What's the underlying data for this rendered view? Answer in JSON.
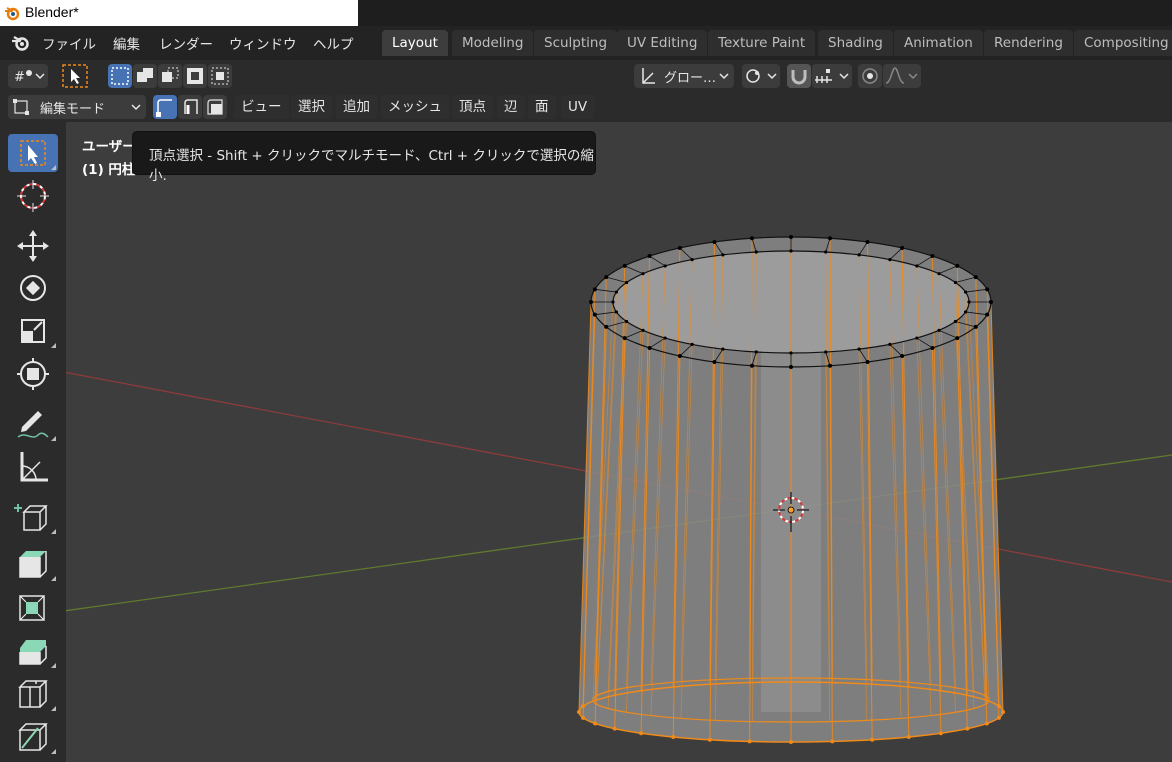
{
  "window": {
    "title": "Blender*"
  },
  "menus": [
    "ファイル",
    "編集",
    "レンダー",
    "ウィンドウ",
    "ヘルプ"
  ],
  "workspace_tabs": [
    {
      "label": "Layout",
      "active": true
    },
    {
      "label": "Modeling",
      "active": false
    },
    {
      "label": "Sculpting",
      "active": false
    },
    {
      "label": "UV Editing",
      "active": false
    },
    {
      "label": "Texture Paint",
      "active": false
    },
    {
      "label": "Shading",
      "active": false
    },
    {
      "label": "Animation",
      "active": false
    },
    {
      "label": "Rendering",
      "active": false
    },
    {
      "label": "Compositing",
      "active": false
    }
  ],
  "header": {
    "transform_orientation": "グロー…",
    "mode": "編集モード",
    "menus": [
      "ビュー",
      "選択",
      "追加",
      "メッシュ",
      "頂点",
      "辺",
      "面",
      "UV"
    ]
  },
  "viewport": {
    "view_label": "ユーザー",
    "object_label": "(1) 円柱"
  },
  "tooltip": {
    "text": "頂点選択 - Shift + クリックでマルチモード、Ctrl + クリックで選択の縮小."
  },
  "tools": [
    "select-box",
    "cursor",
    "move",
    "rotate",
    "scale",
    "transform",
    "annotate",
    "measure",
    "add-cube",
    "extrude",
    "inset",
    "bevel",
    "loop-cut",
    "knife"
  ],
  "colors": {
    "selection": "#4772b3",
    "mesh_selected": "#f08a19",
    "x_axis": "#8c3b3b",
    "y_axis": "#5e7a2e"
  }
}
